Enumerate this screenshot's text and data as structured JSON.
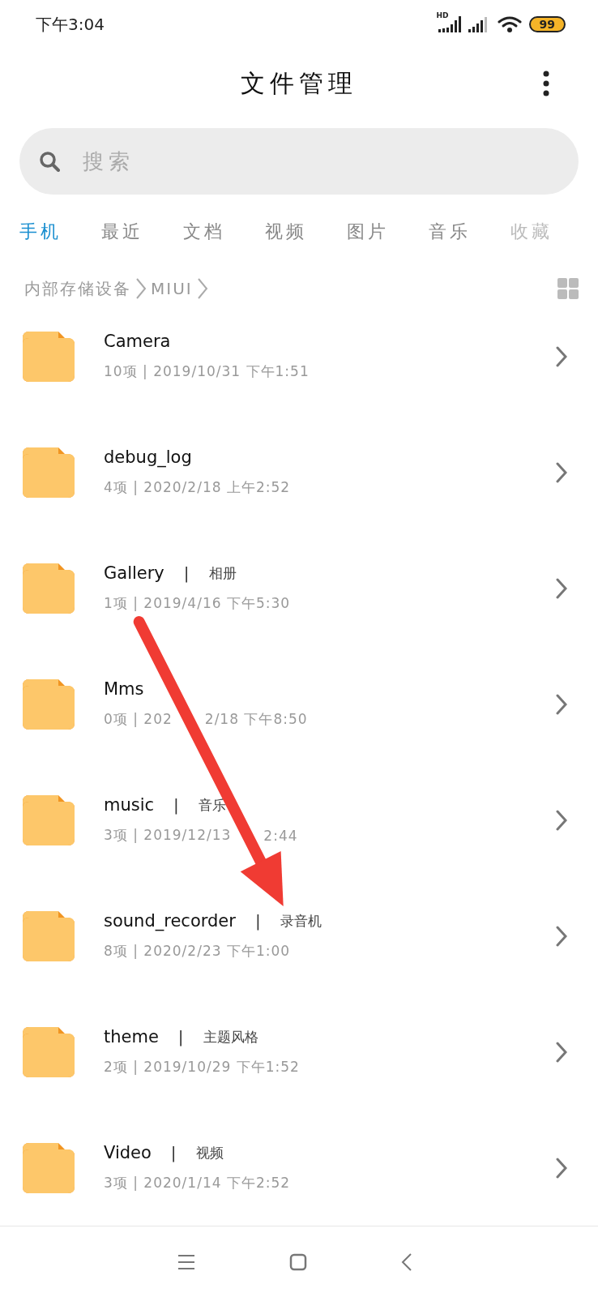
{
  "status_bar": {
    "time": "下午3:04",
    "network_label": "HD",
    "battery": "99"
  },
  "header": {
    "title": "文件管理"
  },
  "search": {
    "placeholder": "搜索"
  },
  "tabs": [
    {
      "label": "手机",
      "selected": true
    },
    {
      "label": "最近",
      "selected": false
    },
    {
      "label": "文档",
      "selected": false
    },
    {
      "label": "视频",
      "selected": false
    },
    {
      "label": "图片",
      "selected": false
    },
    {
      "label": "音乐",
      "selected": false
    },
    {
      "label": "收藏",
      "selected": false
    }
  ],
  "breadcrumb": [
    "内部存储设备",
    "MIUI"
  ],
  "folders": [
    {
      "name": "Camera",
      "meta": "10项 | 2019/10/31 下午1:51"
    },
    {
      "name": "debug_log",
      "meta": "4项 | 2020/2/18 上午2:52"
    },
    {
      "name": "Gallery",
      "separator": "|",
      "alias": "相册",
      "meta": "1项 | 2019/4/16 下午5:30"
    },
    {
      "name": "Mms",
      "meta": [
        "0项 | 202",
        "2/18 下午8:50"
      ]
    },
    {
      "name": "music",
      "separator": "|",
      "alias": "音乐",
      "meta": [
        "3项 | 2019/12/13",
        "2:44"
      ]
    },
    {
      "name": "sound_recorder",
      "separator": "|",
      "alias": "录音机",
      "meta": "8项 | 2020/2/23 下午1:00"
    },
    {
      "name": "theme",
      "separator": "|",
      "alias": "主题风格",
      "meta": "2项 | 2019/10/29 下午1:52"
    },
    {
      "name": "Video",
      "separator": "|",
      "alias": "视频",
      "meta": "3项 | 2020/1/14 下午2:52"
    }
  ],
  "annotation": {
    "kind": "arrow"
  }
}
